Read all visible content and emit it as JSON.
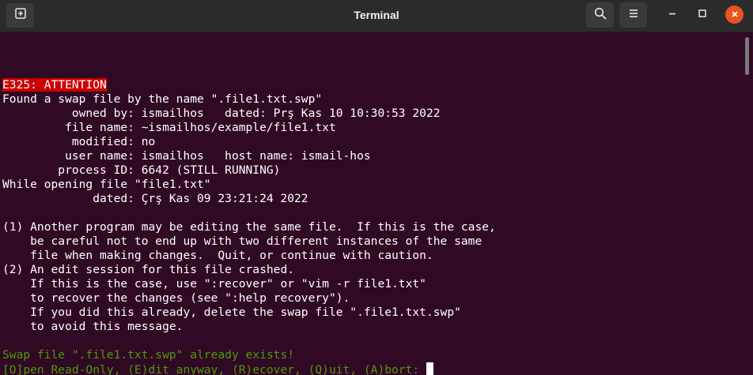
{
  "window": {
    "title": "Terminal"
  },
  "icons": {
    "new_tab": "new-tab-icon",
    "search": "search-icon",
    "menu": "hamburger-menu-icon",
    "minimize": "minimize-icon",
    "maximize": "maximize-icon",
    "close": "close-icon"
  },
  "colors": {
    "terminal_bg": "#300a24",
    "titlebar_bg": "#2b2b2b",
    "error_bg": "#cc0000",
    "warning_text": "#4e9a06",
    "close_button": "#e95420"
  },
  "terminal": {
    "error_code": "E325: ATTENTION",
    "lines": [
      "Found a swap file by the name \".file1.txt.swp\"",
      "          owned by: ismailhos   dated: Prş Kas 10 10:30:53 2022",
      "         file name: ~ismailhos/example/file1.txt",
      "          modified: no",
      "         user name: ismailhos   host name: ismail-hos",
      "        process ID: 6642 (STILL RUNNING)",
      "While opening file \"file1.txt\"",
      "             dated: Çrş Kas 09 23:21:24 2022",
      "",
      "(1) Another program may be editing the same file.  If this is the case,",
      "    be careful not to end up with two different instances of the same",
      "    file when making changes.  Quit, or continue with caution.",
      "(2) An edit session for this file crashed.",
      "    If this is the case, use \":recover\" or \"vim -r file1.txt\"",
      "    to recover the changes (see \":help recovery\").",
      "    If you did this already, delete the swap file \".file1.txt.swp\"",
      "    to avoid this message."
    ],
    "warning": "Swap file \".file1.txt.swp\" already exists!",
    "prompt": "[O]pen Read-Only, (E)dit anyway, (R)ecover, (Q)uit, (A)bort: "
  }
}
